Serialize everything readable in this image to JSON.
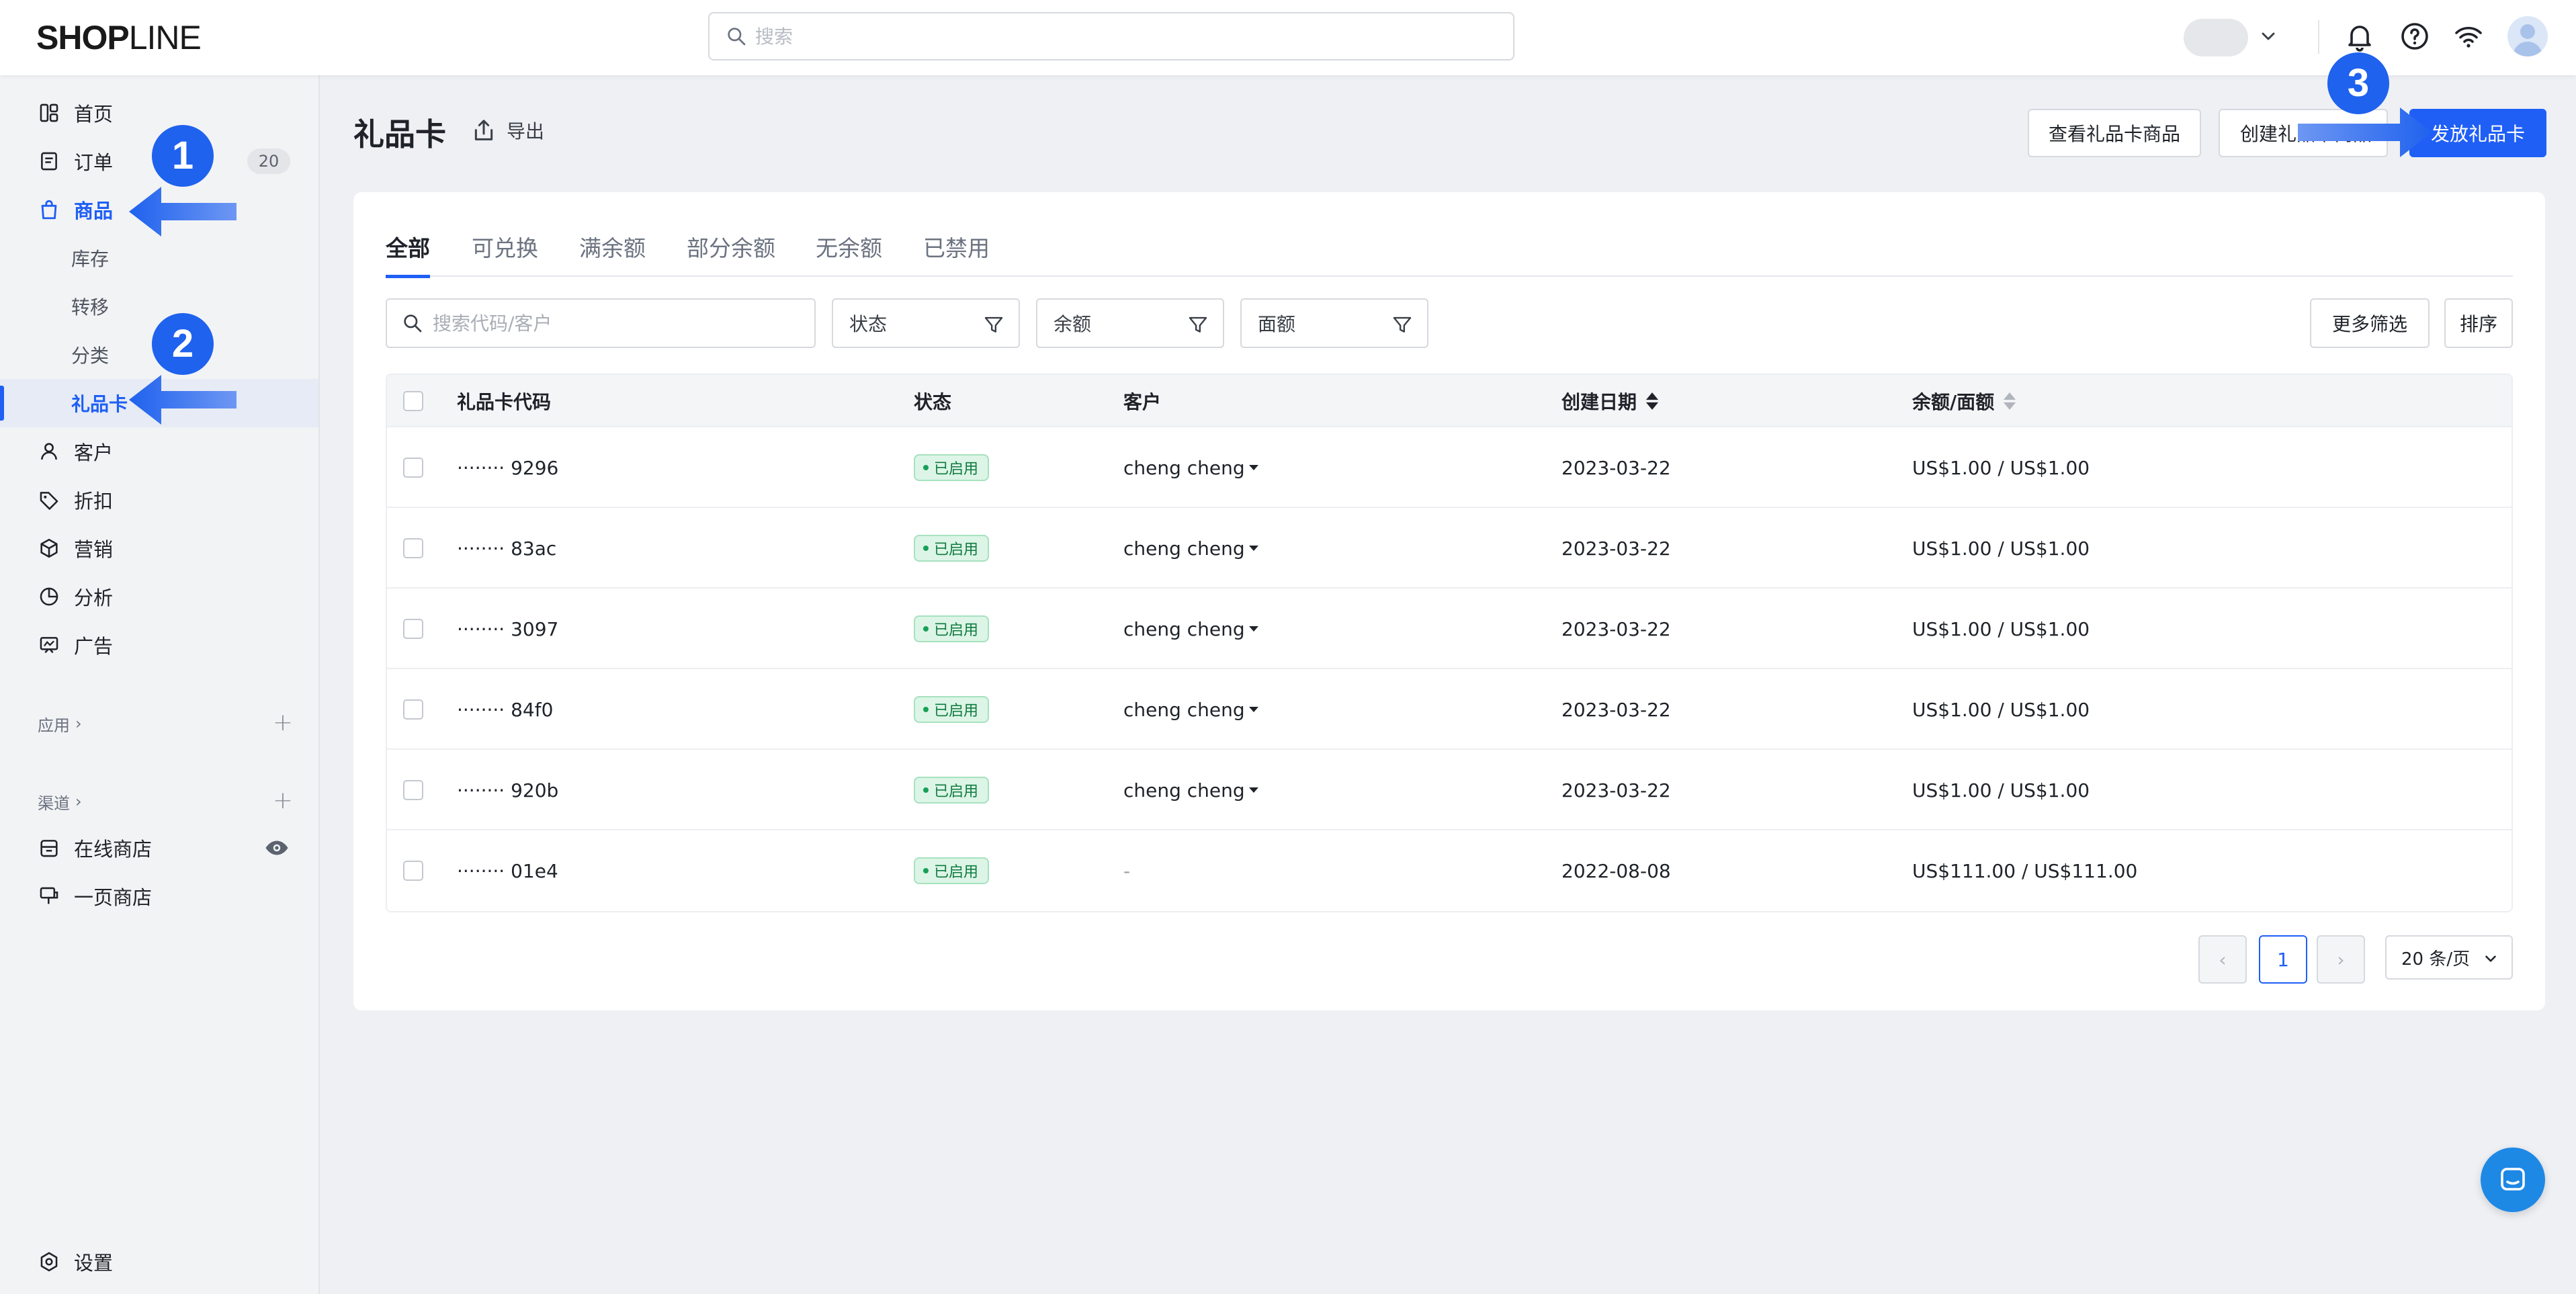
{
  "header": {
    "logo_bold": "SHOP",
    "logo_thin": "LINE",
    "search_placeholder": "搜索"
  },
  "sidebar": {
    "items": [
      {
        "label": "首页",
        "icon": "dashboard-icon"
      },
      {
        "label": "订单",
        "icon": "order-icon",
        "badge": "20"
      },
      {
        "label": "商品",
        "icon": "bag-icon"
      },
      {
        "label": "库存"
      },
      {
        "label": "转移"
      },
      {
        "label": "分类"
      },
      {
        "label": "礼品卡"
      },
      {
        "label": "客户",
        "icon": "user-icon"
      },
      {
        "label": "折扣",
        "icon": "tag-icon"
      },
      {
        "label": "营销",
        "icon": "cube-icon"
      },
      {
        "label": "分析",
        "icon": "pie-icon"
      },
      {
        "label": "广告",
        "icon": "ad-icon"
      }
    ],
    "apps_label": "应用",
    "channels_label": "渠道",
    "channels": [
      {
        "label": "在线商店",
        "icon": "store-icon"
      },
      {
        "label": "一页商店",
        "icon": "onepage-icon"
      }
    ],
    "settings_label": "设置"
  },
  "annotations": {
    "step1": "1",
    "step2": "2",
    "step3": "3"
  },
  "page": {
    "title": "礼品卡",
    "export_label": "导出",
    "actions": {
      "view_products": "查看礼品卡商品",
      "create_product": "创建礼品卡商品",
      "issue": "发放礼品卡"
    },
    "tabs": [
      "全部",
      "可兑换",
      "满余额",
      "部分余额",
      "无余额",
      "已禁用"
    ],
    "filters": {
      "search_placeholder": "搜索代码/客户",
      "status": "状态",
      "balance": "余额",
      "face_value": "面额",
      "more_filters": "更多筛选",
      "sort": "排序"
    }
  },
  "table": {
    "headers": {
      "code": "礼品卡代码",
      "status": "状态",
      "customer": "客户",
      "created": "创建日期",
      "balance": "余额/面额"
    },
    "rows": [
      {
        "code": "········ 9296",
        "status": "已启用",
        "customer": "cheng cheng",
        "created": "2023-03-22",
        "balance": "US$1.00 / US$1.00"
      },
      {
        "code": "········ 83ac",
        "status": "已启用",
        "customer": "cheng cheng",
        "created": "2023-03-22",
        "balance": "US$1.00 / US$1.00"
      },
      {
        "code": "········ 3097",
        "status": "已启用",
        "customer": "cheng cheng",
        "created": "2023-03-22",
        "balance": "US$1.00 / US$1.00"
      },
      {
        "code": "········ 84f0",
        "status": "已启用",
        "customer": "cheng cheng",
        "created": "2023-03-22",
        "balance": "US$1.00 / US$1.00"
      },
      {
        "code": "········ 920b",
        "status": "已启用",
        "customer": "cheng cheng",
        "created": "2023-03-22",
        "balance": "US$1.00 / US$1.00"
      },
      {
        "code": "········ 01e4",
        "status": "已启用",
        "customer": "-",
        "created": "2022-08-08",
        "balance": "US$111.00 / US$111.00"
      }
    ]
  },
  "pagination": {
    "prev": "‹",
    "current": "1",
    "next": "›",
    "page_size": "20 条/页"
  },
  "colors": {
    "accent": "#1f5ff5",
    "status_enabled_bg": "#dcf5e6",
    "status_enabled_text": "#0f7a3f",
    "annotation": "#1f62ee"
  }
}
